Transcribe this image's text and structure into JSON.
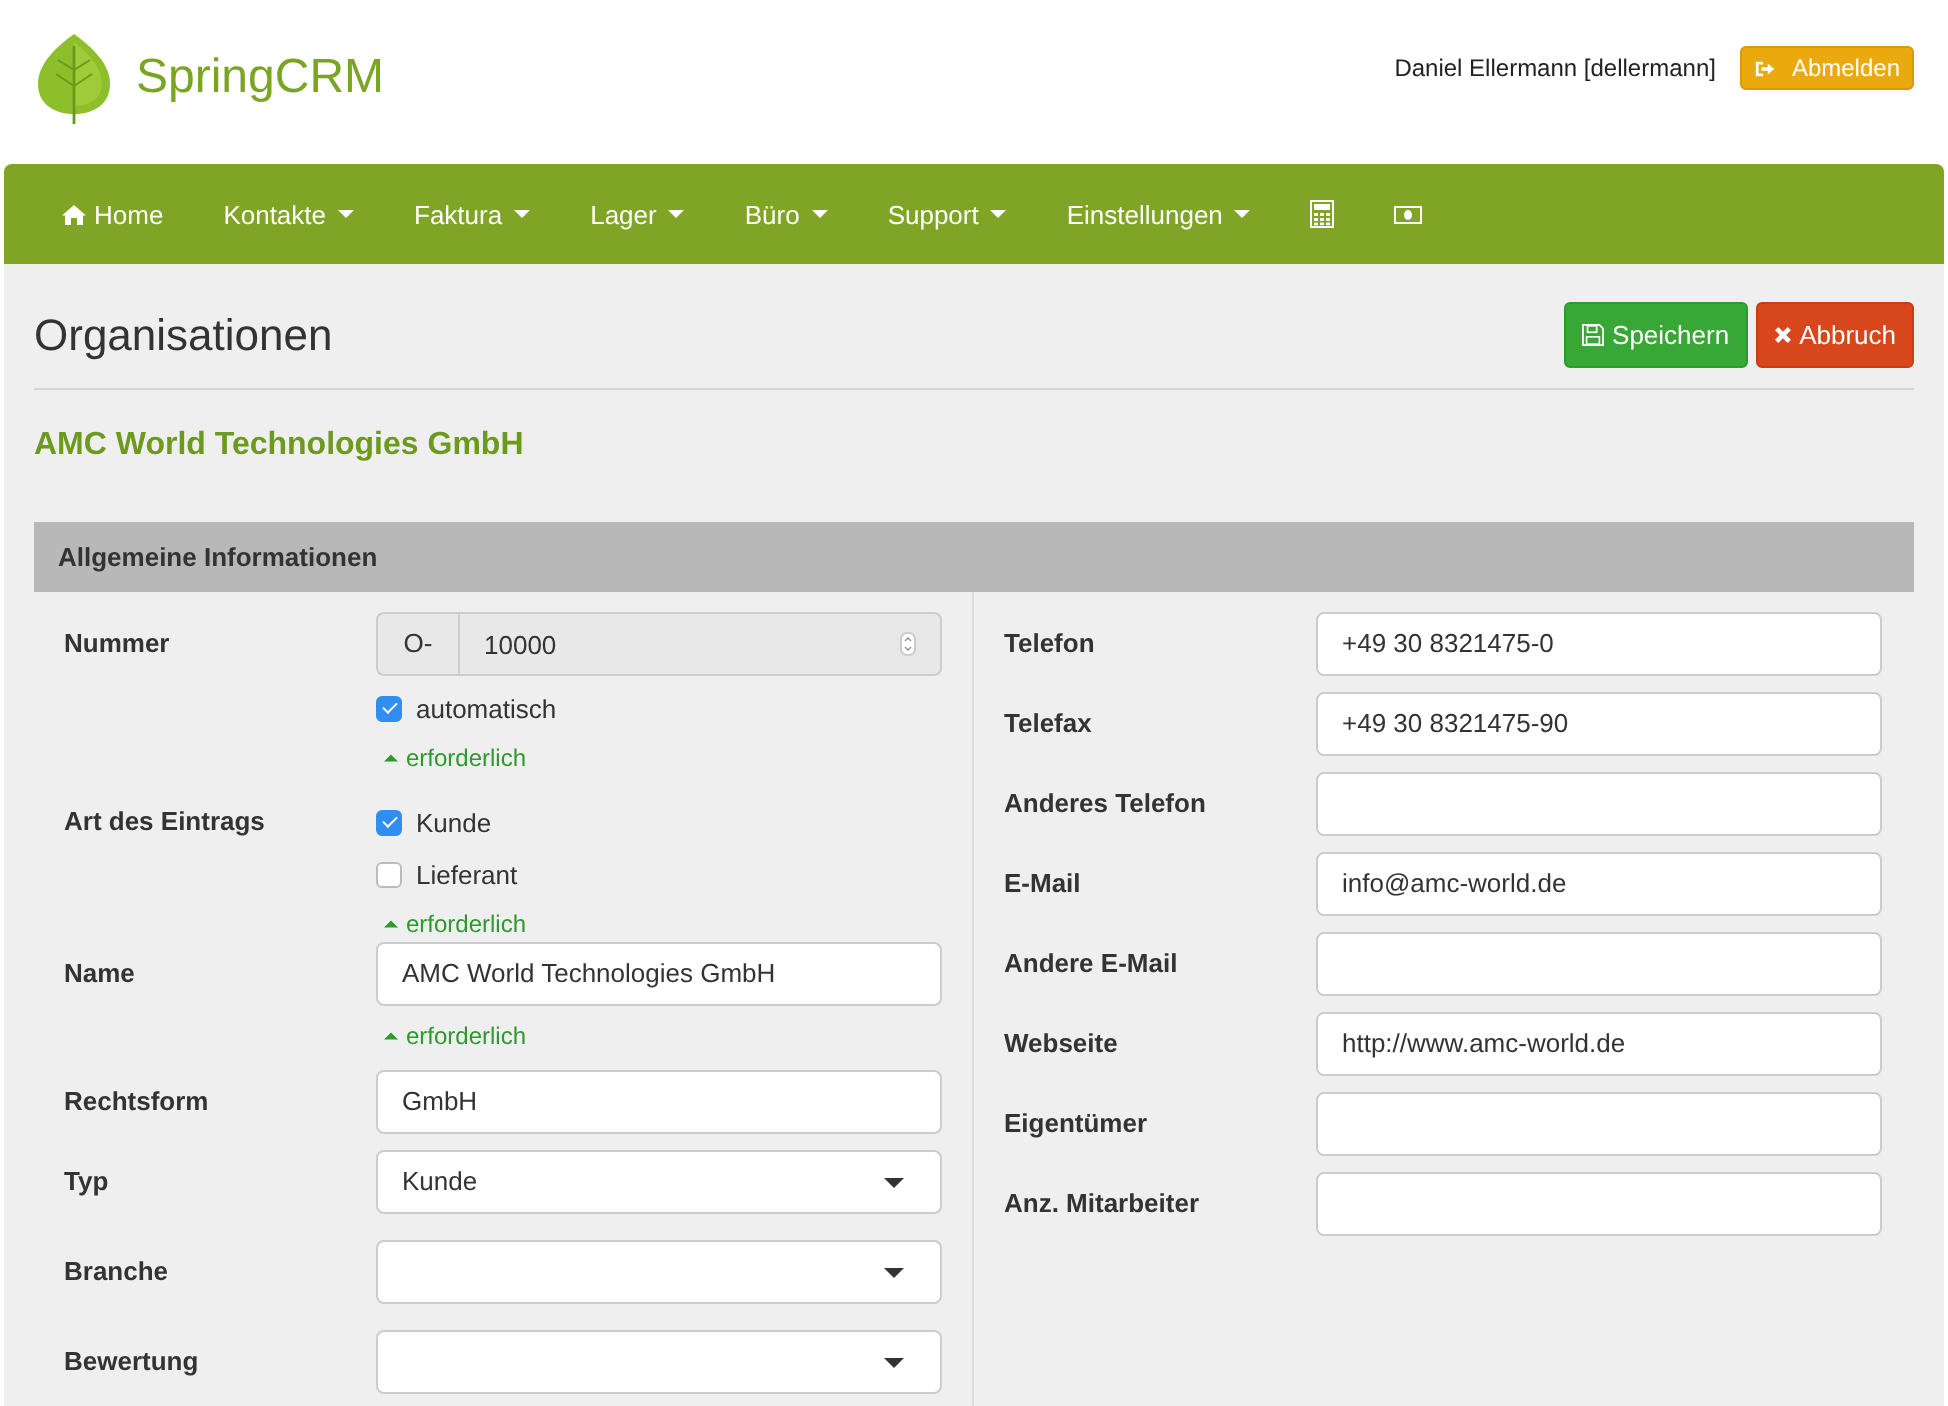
{
  "header": {
    "logo_text": "SpringCRM",
    "user": "Daniel Ellermann [dellermann]",
    "logout": "Abmelden"
  },
  "nav": [
    {
      "kind": "home",
      "label": "Home"
    },
    {
      "kind": "dropdown",
      "label": "Kontakte"
    },
    {
      "kind": "dropdown",
      "label": "Faktura"
    },
    {
      "kind": "dropdown",
      "label": "Lager"
    },
    {
      "kind": "dropdown",
      "label": "Büro"
    },
    {
      "kind": "dropdown",
      "label": "Support"
    },
    {
      "kind": "dropdown",
      "label": "Einstellungen"
    },
    {
      "kind": "calculator"
    },
    {
      "kind": "money"
    }
  ],
  "page": {
    "title": "Organisationen",
    "save": "Speichern",
    "cancel": "Abbruch",
    "subtitle": "AMC World Technologies GmbH",
    "section": "Allgemeine Informationen"
  },
  "left_fields": [
    {
      "kind": "number",
      "label": "Nummer",
      "prefix": "O-",
      "value": "10000",
      "option": {
        "label": "automatisch",
        "checked": true
      },
      "hint": "erforderlich"
    },
    {
      "kind": "checkboxes",
      "label": "Art des Eintrags",
      "options": [
        {
          "label": "Kunde",
          "checked": true
        },
        {
          "label": "Lieferant",
          "checked": false
        }
      ],
      "hint": "erforderlich"
    },
    {
      "kind": "text",
      "label": "Name",
      "value": "AMC World Technologies GmbH",
      "hint": "erforderlich"
    },
    {
      "kind": "text",
      "label": "Rechtsform",
      "value": "GmbH"
    },
    {
      "kind": "select",
      "label": "Typ",
      "value": "Kunde"
    },
    {
      "kind": "select",
      "label": "Branche"
    },
    {
      "kind": "select",
      "label": "Bewertung"
    }
  ],
  "right_fields": [
    {
      "label": "Telefon",
      "value": "+49 30 8321475-0"
    },
    {
      "label": "Telefax",
      "value": "+49 30 8321475-90"
    },
    {
      "label": "Anderes Telefon"
    },
    {
      "label": "E-Mail",
      "value": "info@amc-world.de"
    },
    {
      "label": "Andere E-Mail"
    },
    {
      "label": "Webseite",
      "value": "http://www.amc-world.de"
    },
    {
      "label": "Eigentümer"
    },
    {
      "label": "Anz. Mitarbeiter"
    }
  ]
}
